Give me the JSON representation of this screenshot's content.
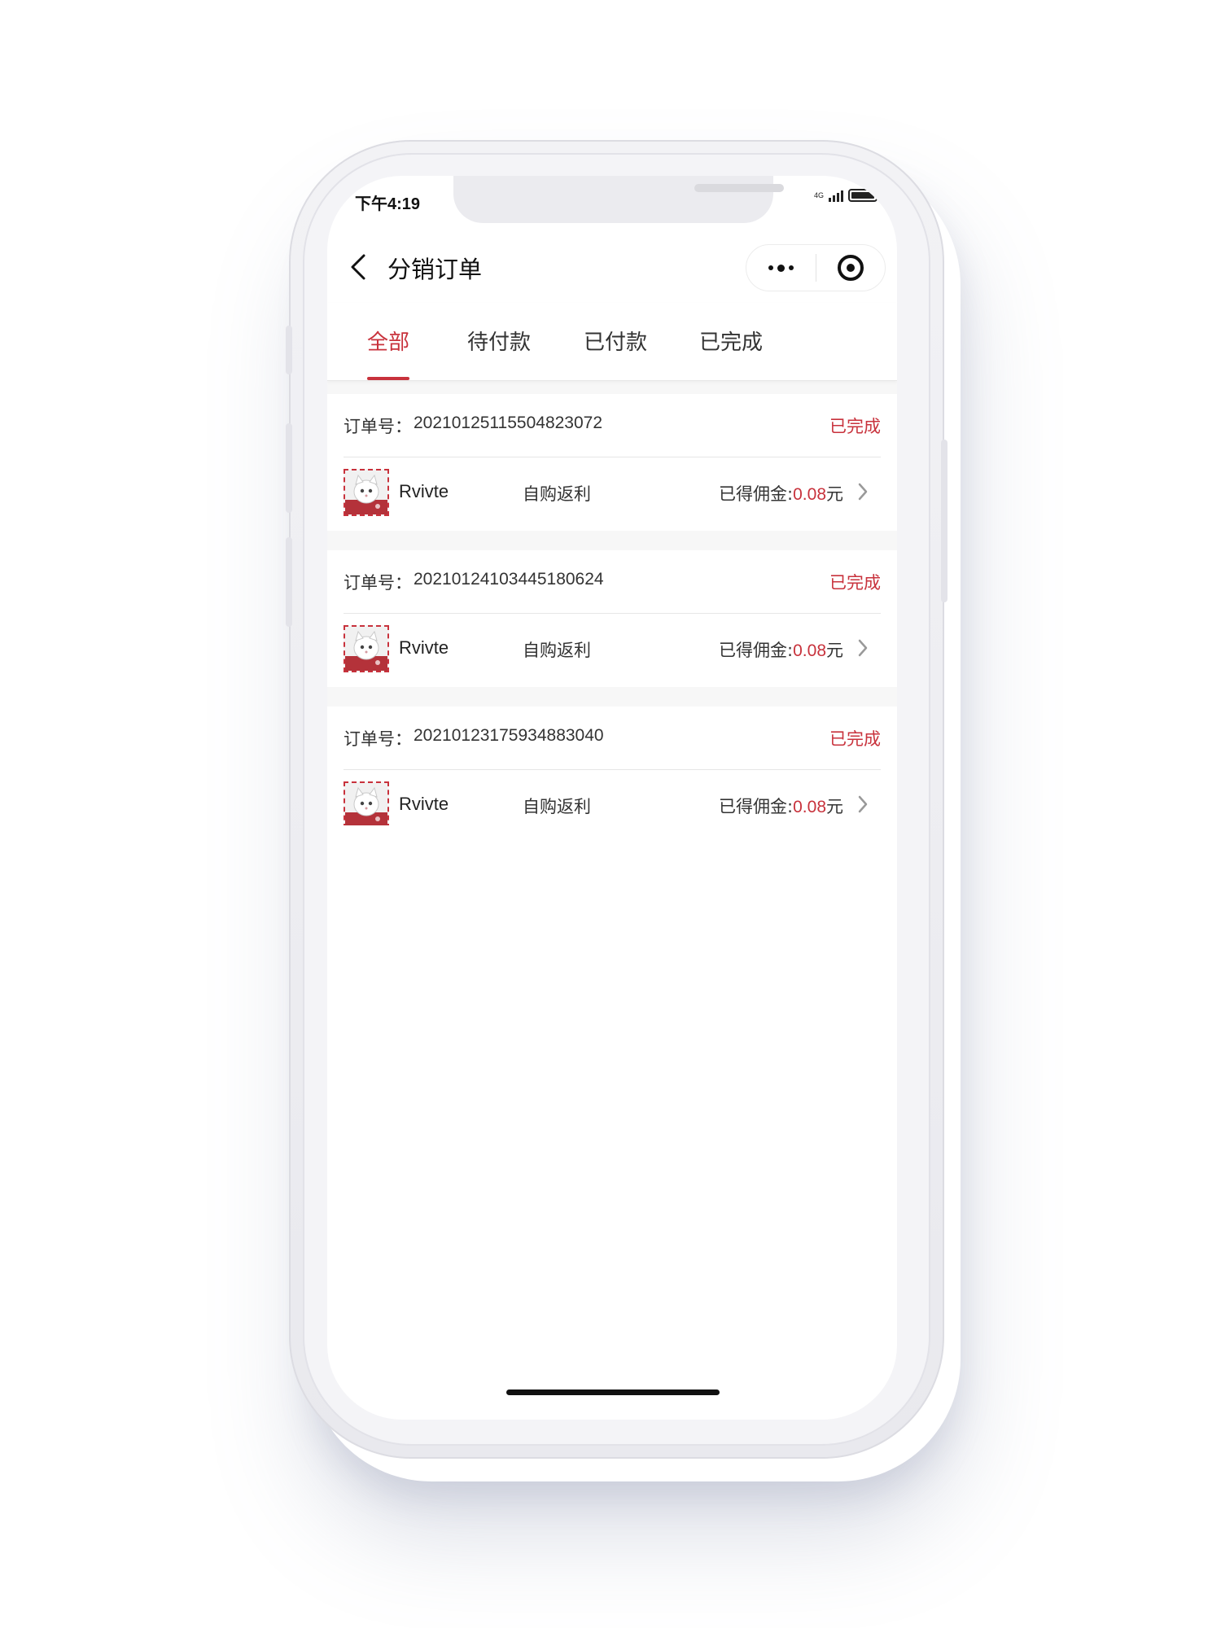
{
  "status_bar": {
    "time": "下午4:19",
    "network": "4G"
  },
  "nav": {
    "title": "分销订单"
  },
  "tabs": [
    {
      "label": "全部",
      "active": true
    },
    {
      "label": "待付款",
      "active": false
    },
    {
      "label": "已付款",
      "active": false
    },
    {
      "label": "已完成",
      "active": false
    }
  ],
  "orders": [
    {
      "order_no_label": "订单号：",
      "order_no": "20210125115504823072",
      "status": "已完成",
      "user_name": "Rvivte",
      "type": "自购返利",
      "commission_label": "已得佣金:",
      "commission_amount": "0.08",
      "commission_unit": "元"
    },
    {
      "order_no_label": "订单号：",
      "order_no": "20210124103445180624",
      "status": "已完成",
      "user_name": "Rvivte",
      "type": "自购返利",
      "commission_label": "已得佣金:",
      "commission_amount": "0.08",
      "commission_unit": "元"
    },
    {
      "order_no_label": "订单号：",
      "order_no": "20210123175934883040",
      "status": "已完成",
      "user_name": "Rvivte",
      "type": "自购返利",
      "commission_label": "已得佣金:",
      "commission_amount": "0.08",
      "commission_unit": "元"
    }
  ],
  "colors": {
    "accent": "#c8323c",
    "page_bg": "#f7f7f7"
  },
  "icons": {
    "back": "chevron-left-icon",
    "more": "more-dots-icon",
    "close": "target-circle-icon",
    "row_arrow": "chevron-right-icon"
  }
}
